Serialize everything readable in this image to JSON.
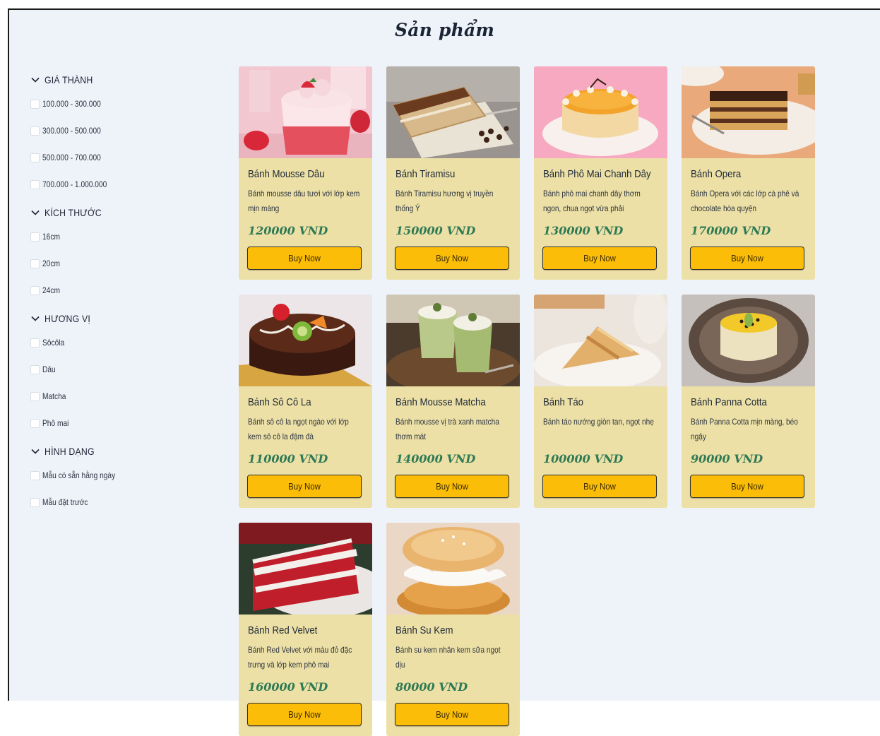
{
  "page": {
    "title": "Sản phẩm"
  },
  "filters": [
    {
      "title": "GIÁ THÀNH",
      "options": [
        "100.000 - 300.000",
        "300.000 - 500.000",
        "500.000 - 700.000",
        "700.000 - 1.000.000"
      ]
    },
    {
      "title": "KÍCH THƯỚC",
      "options": [
        "16cm",
        "20cm",
        "24cm"
      ]
    },
    {
      "title": "HƯƠNG VỊ",
      "options": [
        "Sôcôla",
        "Dâu",
        "Matcha",
        "Phô mai"
      ]
    },
    {
      "title": "HÌNH DẠNG",
      "options": [
        "Mẫu có sẵn hằng ngày",
        "Mẫu đặt trước"
      ]
    }
  ],
  "buy_label": "Buy Now",
  "products": [
    {
      "name": "Bánh Mousse Dâu",
      "desc": "Bánh mousse dâu tươi với lớp kem mịn màng",
      "price": "120000 VND",
      "image": "strawberry-mousse"
    },
    {
      "name": "Bánh Tiramisu",
      "desc": "Bánh Tiramisu hương vị truyền thống Ý",
      "price": "150000 VND",
      "image": "tiramisu"
    },
    {
      "name": "Bánh Phô Mai Chanh Dây",
      "desc": "Bánh phô mai chanh dây thơm ngon, chua ngọt vừa phải",
      "price": "130000 VND",
      "image": "passionfruit-cheesecake"
    },
    {
      "name": "Bánh Opera",
      "desc": "Bánh Opera với các lớp cà phê và chocolate hòa quyện",
      "price": "170000 VND",
      "image": "opera-cake"
    },
    {
      "name": "Bánh Sô Cô La",
      "desc": "Bánh sô cô la ngọt ngào với lớp kem sô cô la đậm đà",
      "price": "110000 VND",
      "image": "chocolate-cake"
    },
    {
      "name": "Bánh Mousse Matcha",
      "desc": "Bánh mousse vị trà xanh matcha thơm mát",
      "price": "140000 VND",
      "image": "matcha-mousse"
    },
    {
      "name": "Bánh Táo",
      "desc": "Bánh táo nướng giòn tan, ngọt nhẹ",
      "price": "100000 VND",
      "image": "apple-pie"
    },
    {
      "name": "Bánh Panna Cotta",
      "desc": "Bánh Panna Cotta mịn màng, béo ngậy",
      "price": "90000 VND",
      "image": "panna-cotta"
    },
    {
      "name": "Bánh Red Velvet",
      "desc": "Bánh Red Velvet với màu đỏ đặc trưng và lớp kem phô mai",
      "price": "160000 VND",
      "image": "red-velvet"
    },
    {
      "name": "Bánh Su Kem",
      "desc": "Bánh su kem nhân kem sữa ngọt dịu",
      "price": "80000 VND",
      "image": "cream-puff"
    }
  ],
  "colors": {
    "card_bg": "#ece0a6",
    "button_bg": "#fbbd07",
    "price": "#2e7a55",
    "page_bg": "#eef3fa"
  }
}
